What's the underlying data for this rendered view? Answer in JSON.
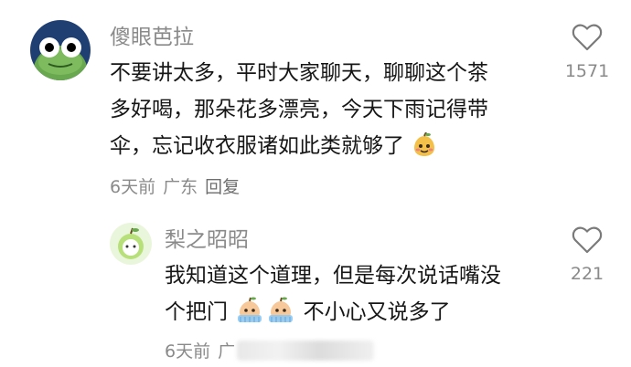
{
  "comments": [
    {
      "username": "傻眼芭拉",
      "lines": [
        "不要讲太多，平时大家聊天，聊聊这个茶",
        "多好喝，那朵花多漂亮，今天下雨记得带",
        "伞，忘记收衣服诸如此类就够了"
      ],
      "time": "6天前",
      "location": "广东",
      "reply_label": "回复",
      "like_count": "1571"
    },
    {
      "username": "梨之昭昭",
      "lines": [
        "我知道这个道理，但是每次说话嘴没",
        "个把门",
        "不小心又说多了"
      ],
      "time": "6天前",
      "location": "广",
      "like_count": "221"
    }
  ],
  "icons": {
    "like": "heart-outline-icon",
    "emoji_pear": "pear-emoji-icon",
    "emoji_pear_cry": "pear-crying-emoji-icon"
  }
}
